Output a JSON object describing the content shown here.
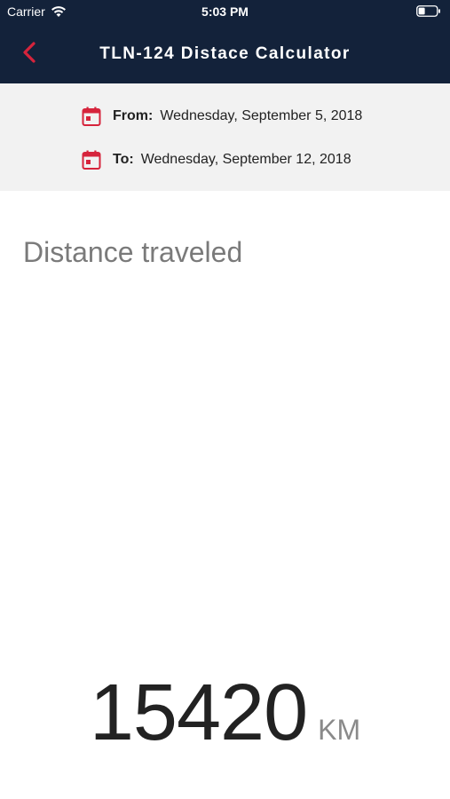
{
  "status_bar": {
    "carrier": "Carrier",
    "time": "5:03 PM"
  },
  "nav": {
    "title": "TLN-124 Distace Calculator",
    "back_icon": "chevron-left-icon"
  },
  "dates": {
    "from": {
      "label": "From:",
      "value": "Wednesday, September 5, 2018",
      "icon": "calendar-icon"
    },
    "to": {
      "label": "To:",
      "value": "Wednesday, September 12, 2018",
      "icon": "calendar-icon"
    }
  },
  "distance": {
    "title": "Distance traveled",
    "value": "15420",
    "unit": "KM"
  },
  "colors": {
    "header_bg": "#13223a",
    "accent": "#d6243c",
    "date_panel_bg": "#f2f2f2"
  }
}
